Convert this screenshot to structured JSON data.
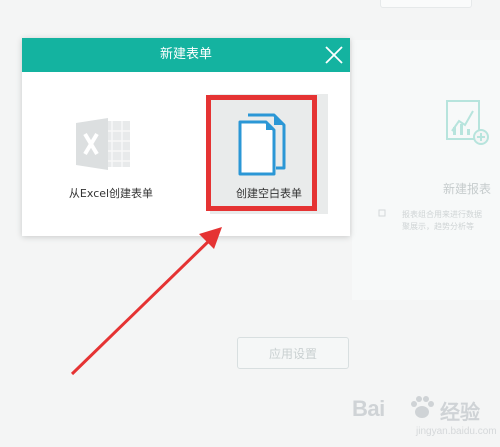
{
  "modal": {
    "title": "新建表单",
    "options": [
      {
        "label": "从Excel创建表单",
        "icon": "excel-icon"
      },
      {
        "label": "创建空白表单",
        "icon": "blank-document-icon"
      }
    ]
  },
  "background": {
    "report_title": "新建报表",
    "report_desc": [
      "报表组合用来进行数据",
      "聚展示，趋势分析等"
    ],
    "apply_button": "应用设置"
  },
  "watermark": {
    "logo": "Bai",
    "text": "经验",
    "url": "jingyan.baidu.com"
  },
  "colors": {
    "header": "#14b3a0",
    "highlight": "#e53333",
    "blank_icon": "#2b97d6"
  }
}
